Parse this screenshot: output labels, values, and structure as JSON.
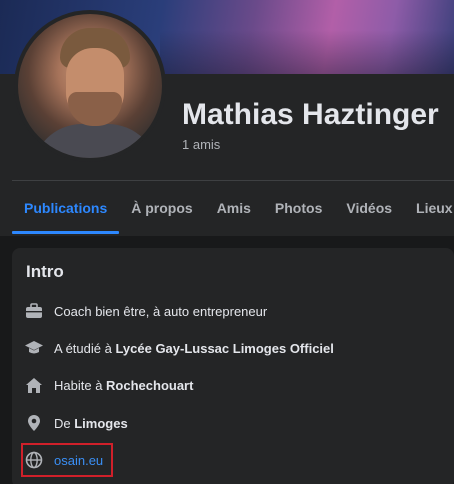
{
  "profile": {
    "name": "Mathias Haztinger",
    "friends": "1 amis"
  },
  "tabs": [
    {
      "label": "Publications",
      "active": true
    },
    {
      "label": "À propos",
      "active": false
    },
    {
      "label": "Amis",
      "active": false
    },
    {
      "label": "Photos",
      "active": false
    },
    {
      "label": "Vidéos",
      "active": false
    },
    {
      "label": "Lieux",
      "active": false
    }
  ],
  "intro": {
    "title": "Intro",
    "work": {
      "icon": "briefcase-icon",
      "text": "Coach bien être, à auto entrepreneur"
    },
    "education": {
      "icon": "graduation-cap-icon",
      "prefix": "A étudié à ",
      "place": "Lycée Gay-Lussac Limoges Officiel"
    },
    "home": {
      "icon": "house-icon",
      "prefix": "Habite à ",
      "place": "Rochechouart"
    },
    "hometown": {
      "icon": "location-pin-icon",
      "prefix": "De ",
      "place": "Limoges"
    },
    "website": {
      "icon": "globe-icon",
      "text": "osain.eu"
    }
  },
  "colors": {
    "accent": "#2d88ff",
    "highlight_border": "#d0202a",
    "card": "#242526",
    "background": "#18191a"
  }
}
